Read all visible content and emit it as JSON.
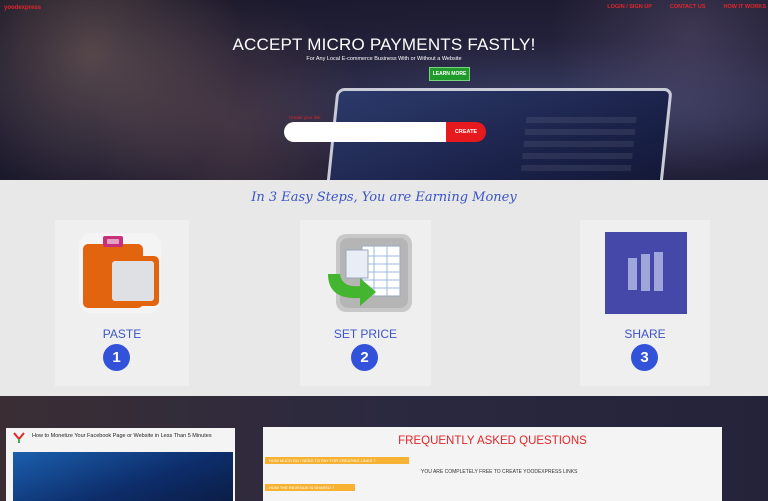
{
  "header": {
    "brand": "yoodexpress",
    "nav": [
      "LOGIN / SIGN UP",
      "CONTACT US",
      "HOW IT WORKS"
    ]
  },
  "hero": {
    "title": "ACCEPT MICRO PAYMENTS FASTLY!",
    "subtitle": "For Any Local E-commerce Business With or Without a Website",
    "learn_more": "LEARN MORE",
    "input_label": "Create your link",
    "input_value": "",
    "create_button": "CREATE"
  },
  "steps": {
    "heading": "In 3 Easy Steps, You are Earning Money",
    "items": [
      {
        "label": "PASTE",
        "number": "1",
        "icon": "clipboard-icon"
      },
      {
        "label": "SET PRICE",
        "number": "2",
        "icon": "spreadsheet-icon"
      },
      {
        "label": "SHARE",
        "number": "3",
        "icon": "share-bars-icon"
      }
    ]
  },
  "video": {
    "title": "How to Monetize Your Facebook Page or Website in Less Than 5 Minutes"
  },
  "faq": {
    "title": "FREQUENTLY ASKED QUESTIONS",
    "questions": [
      {
        "q": "HOW MUCH DO I NEED TO PAY FOR CREATING LINKS ?",
        "a": "YOU ARE COMPLETELY FREE TO CREATE YOODEXPRESS LINKS"
      },
      {
        "q": "HOW THE REVENUE IS SHARED ?",
        "a": ""
      }
    ]
  },
  "colors": {
    "accent_red": "#e5191e",
    "step_blue": "#3152d9",
    "learn_green": "#1f9a2b",
    "faq_question_bg": "#f7b233"
  }
}
